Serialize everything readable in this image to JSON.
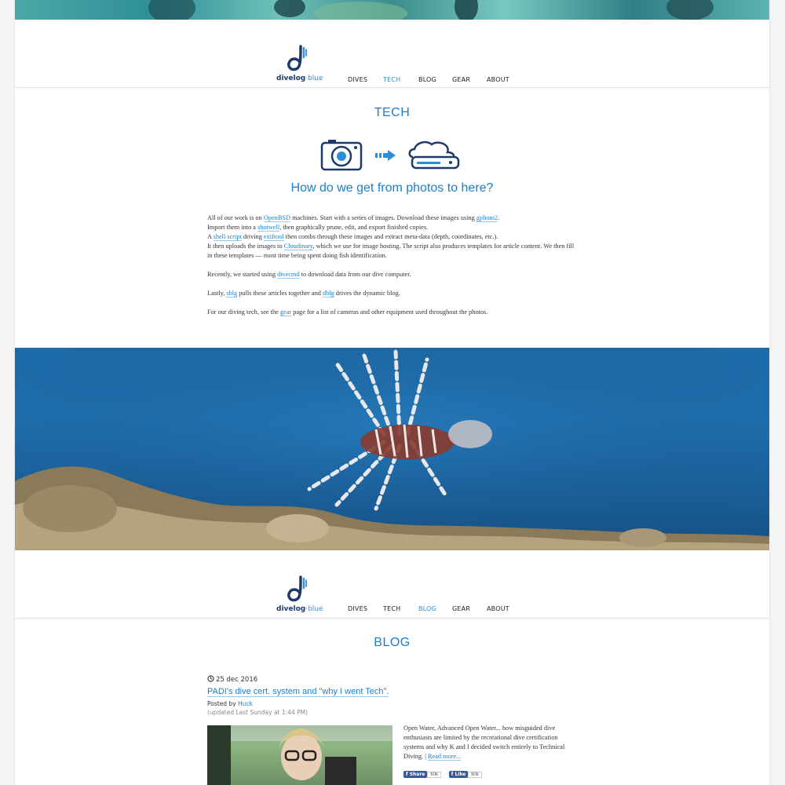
{
  "brand": {
    "name_part1": "divelog",
    "name_part2": "·blue"
  },
  "nav_top": {
    "items": [
      {
        "label": "DIVES",
        "active": false
      },
      {
        "label": "TECH",
        "active": true
      },
      {
        "label": "BLOG",
        "active": false
      },
      {
        "label": "GEAR",
        "active": false
      },
      {
        "label": "ABOUT",
        "active": false
      }
    ]
  },
  "tech": {
    "title": "TECH",
    "heading": "How do we get from photos to here?",
    "p1": {
      "t1": "All of our work is on ",
      "l1": "OpenBSD",
      "t2": " machines. Start with a series of images. Download these images using ",
      "l2": "gphoto2",
      "t3": ".",
      "t4": "Import them into a ",
      "l3": "shotwell",
      "t5": ", then graphically prune, edit, and export finished copies.",
      "t6": "A ",
      "l4": "shell script",
      "t7": " driving ",
      "l5": "exiftool",
      "t8": " then combs through these images and extract meta-data (depth, coordinates, etc.).",
      "t9": "It then uploads the images to ",
      "l6": "Cloudinary",
      "t10": ", which we use for image hosting. The script also produces templates for article content. We then fill in these templates — most time being spent doing fish identification."
    },
    "p2": {
      "t1": "Recently, we started using ",
      "l1": "divecmd",
      "t2": " to download data from our dive computer."
    },
    "p3": {
      "t1": "Lastly, ",
      "l1": "sblg",
      "t2": " pulls these articles together and ",
      "l2": "dblg",
      "t3": " drives the dynamic blog."
    },
    "p4": {
      "t1": "For our diving tech, see the ",
      "l1": "gear",
      "t2": " page for a list of cameras and other equipment used throughout the photos."
    }
  },
  "nav_bottom": {
    "items": [
      {
        "label": "DIVES",
        "active": false
      },
      {
        "label": "TECH",
        "active": false
      },
      {
        "label": "BLOG",
        "active": true
      },
      {
        "label": "GEAR",
        "active": false
      },
      {
        "label": "ABOUT",
        "active": false
      }
    ]
  },
  "blog": {
    "title": "BLOG",
    "post": {
      "date": "25 dec 2016",
      "title": "PADI's dive cert. system and \"why I went Tech\".",
      "posted_by_label": "Posted by ",
      "author": "Huck",
      "updated": "(updated Last Sunday at 1:44 PM)",
      "excerpt": "Open Water, Advanced Open Water... how misguided dive enthusiasts are limited by the recreational dive certification systems and why K and I decided switch entirely to Technical Diving.",
      "read_more": "Read more...",
      "share_label": "Share",
      "share_count": "60k",
      "like_label": "Like",
      "like_count": "60k"
    }
  },
  "colors": {
    "accent": "#1a7fc8",
    "nav_active": "#2b8fd8",
    "logo_dark": "#1d3a6b"
  },
  "icons": {
    "camera": "camera-icon",
    "arrow": "arrow-right-icon",
    "cloud": "cloud-storage-icon",
    "clock": "clock-icon"
  }
}
